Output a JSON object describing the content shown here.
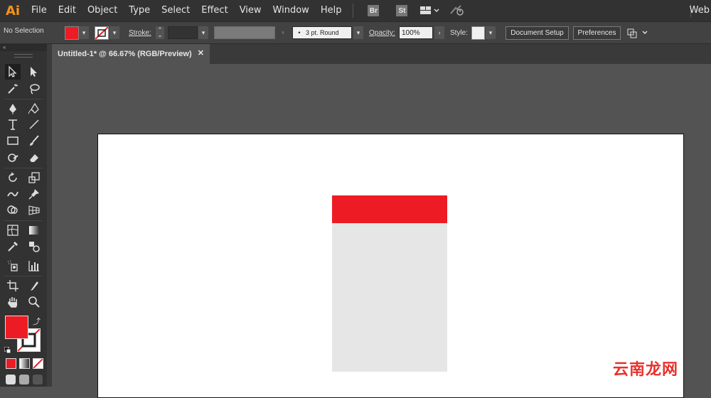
{
  "app": {
    "logo": "Ai",
    "workspace": "Web"
  },
  "menu": [
    "File",
    "Edit",
    "Object",
    "Type",
    "Select",
    "Effect",
    "View",
    "Window",
    "Help"
  ],
  "app_badges": [
    "Br",
    "St"
  ],
  "control": {
    "selection": "No Selection",
    "stroke_label": "Stroke:",
    "brush": "3 pt. Round",
    "brush_dot": "•",
    "opacity_label": "Opacity:",
    "opacity_value": "100%",
    "style_label": "Style:",
    "document_setup": "Document Setup",
    "preferences": "Preferences"
  },
  "tab": {
    "title": "Untitled-1* @ 66.67% (RGB/Preview)",
    "close": "✕"
  },
  "panel": {
    "collapse": "«"
  },
  "colors": {
    "fill": "#ed1c24",
    "shape_top": "#ed1c24",
    "shape_body": "#e6e6e6",
    "accent": "#f7931e"
  },
  "watermark": "云南龙网"
}
